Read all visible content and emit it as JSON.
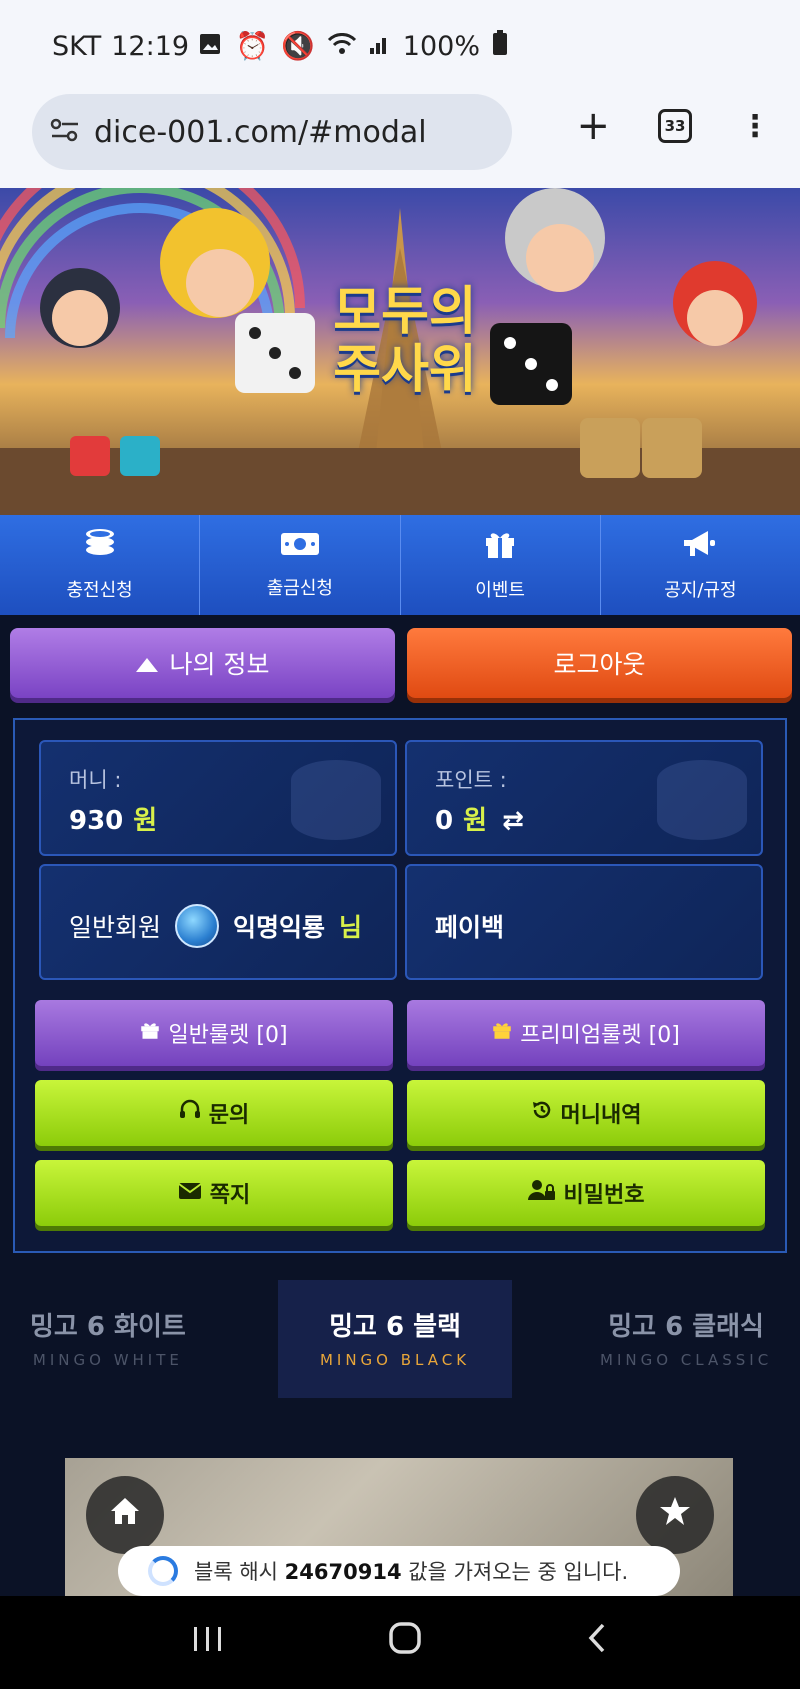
{
  "status": {
    "carrier": "SKT",
    "time": "12:19",
    "battery": "100%"
  },
  "browser": {
    "url": "dice-001.com/#modal",
    "tab_count": "33"
  },
  "banner": {
    "logo_line1": "모두의",
    "logo_line2": "주사위"
  },
  "quicknav": [
    {
      "label": "충전신청",
      "icon": "coins-icon"
    },
    {
      "label": "출금신청",
      "icon": "cash-icon"
    },
    {
      "label": "이벤트",
      "icon": "gift-icon"
    },
    {
      "label": "공지/규정",
      "icon": "megaphone-icon"
    }
  ],
  "account": {
    "myinfo_label": "나의 정보",
    "logout_label": "로그아웃",
    "money_label": "머니 :",
    "money_value": "930",
    "currency": "원",
    "point_label": "포인트 :",
    "point_value": "0",
    "grade_label": "일반회원",
    "nickname": "익명익룡",
    "honorific": "님",
    "payback_label": "페이백"
  },
  "buttons": {
    "roulette_normal": "일반룰렛 [0]",
    "roulette_premium": "프리미엄룰렛 [0]",
    "inquiry": "문의",
    "money_history": "머니내역",
    "message": "쪽지",
    "password": "비밀번호"
  },
  "game_tabs": [
    {
      "title": "밍고 6 화이트",
      "subtitle": "MINGO WHITE",
      "active": false
    },
    {
      "title": "밍고 6 블랙",
      "subtitle": "MINGO BLACK",
      "active": true
    },
    {
      "title": "밍고 6 클래식",
      "subtitle": "MINGO CLASSIC",
      "active": false
    }
  ],
  "toast": {
    "prefix": "블록 해시",
    "hash": "24670914",
    "suffix": "값을 가져오는 중 입니다."
  },
  "colors": {
    "accent_blue": "#2f6ee2",
    "purple": "#8a55d0",
    "orange": "#f0601e",
    "lime": "#a8e020",
    "gold_text": "#e8a63a"
  }
}
